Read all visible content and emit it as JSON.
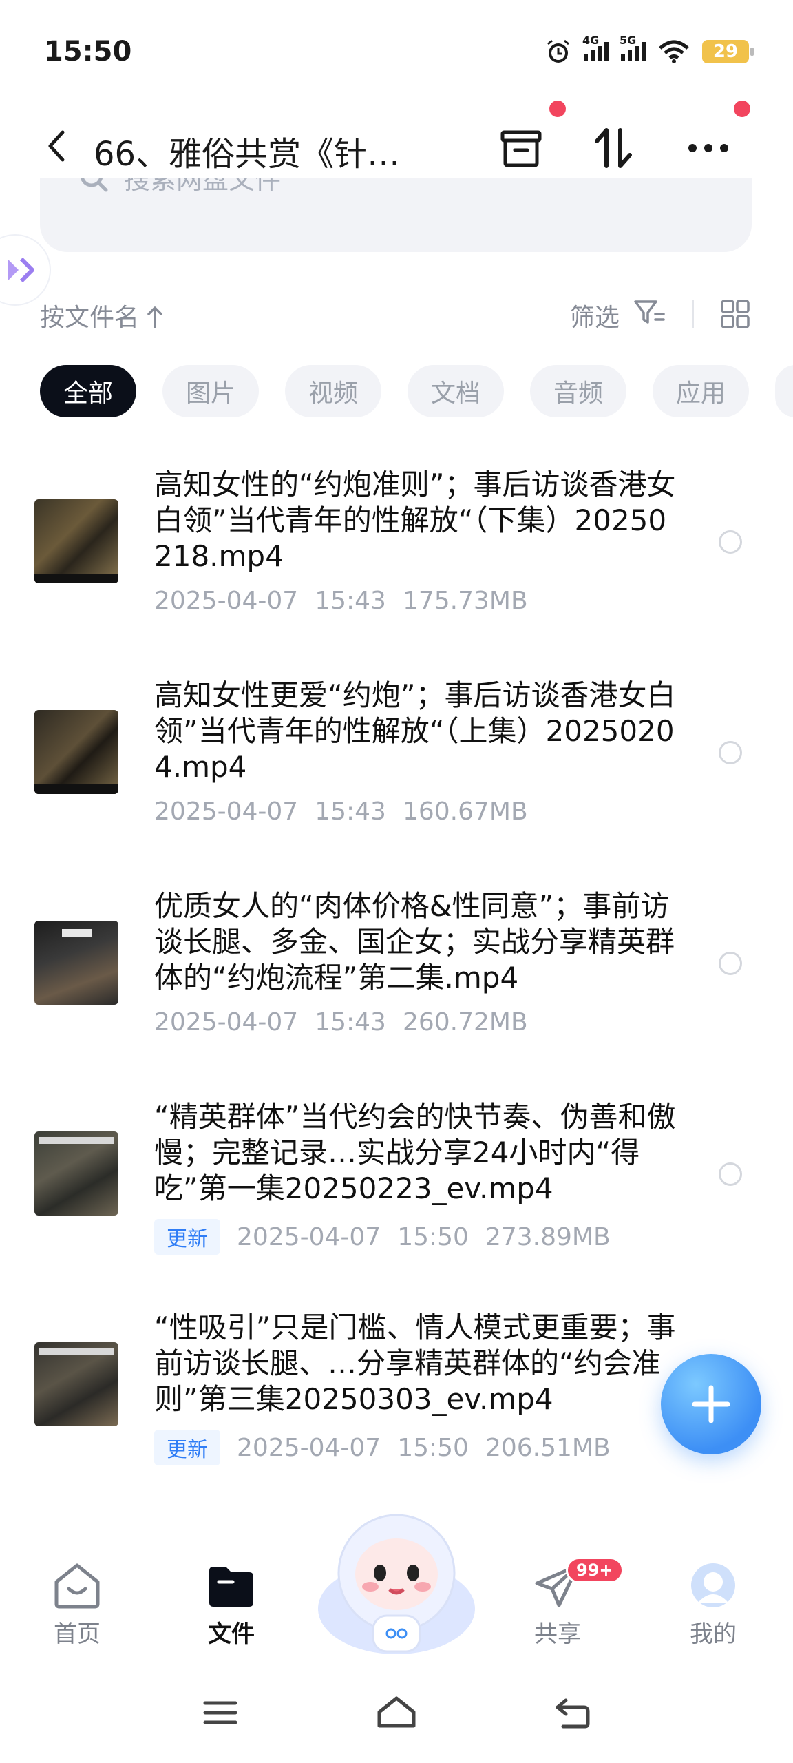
{
  "status_bar": {
    "time": "15:50",
    "network_1": "4G",
    "network_2": "5G",
    "battery": "29"
  },
  "header": {
    "title": "66、雅俗共赏《针…",
    "back_icon": "chevron-left-icon",
    "actions": [
      "archive-icon",
      "sort-transfer-icon",
      "more-icon"
    ]
  },
  "search": {
    "placeholder": "搜索网盘文件"
  },
  "sort_bar": {
    "sort_label": "按文件名",
    "filter_label": "筛选"
  },
  "chips": [
    {
      "label": "全部",
      "active": true
    },
    {
      "label": "图片",
      "active": false
    },
    {
      "label": "视频",
      "active": false
    },
    {
      "label": "文档",
      "active": false
    },
    {
      "label": "音频",
      "active": false
    },
    {
      "label": "应用",
      "active": false
    }
  ],
  "files": [
    {
      "name": "高知女性的“约炮准则”；事后访谈香港女白领”当代青年的性解放“（下集）20250218.mp4",
      "date": "2025-04-07",
      "time": "15:43",
      "size": "175.73MB",
      "badge": ""
    },
    {
      "name": "高知女性更爱“约炮”；事后访谈香港女白领”当代青年的性解放“（上集）20250204.mp4",
      "date": "2025-04-07",
      "time": "15:43",
      "size": "160.67MB",
      "badge": ""
    },
    {
      "name": "优质女人的“肉体价格&性同意”；事前访谈长腿、多金、国企女；实战分享精英群体的“约炮流程”第二集.mp4",
      "date": "2025-04-07",
      "time": "15:43",
      "size": "260.72MB",
      "badge": ""
    },
    {
      "name": "“精英群体”当代约会的快节奏、伪善和傲慢；完整记录…实战分享24小时内“得吃”第一集20250223_ev.mp4",
      "date": "2025-04-07",
      "time": "15:50",
      "size": "273.89MB",
      "badge": "更新"
    },
    {
      "name": "“性吸引”只是门槛、情人模式更重要；事前访谈长腿、…分享精英群体的“约会准则”第三集20250303_ev.mp4",
      "date": "2025-04-07",
      "time": "15:50",
      "size": "206.51MB",
      "badge": "更新"
    }
  ],
  "bottom_nav": [
    {
      "label": "首页",
      "icon": "home-icon",
      "active": false
    },
    {
      "label": "文件",
      "icon": "folder-icon",
      "active": true
    },
    {
      "label": "共享",
      "icon": "paper-plane-icon",
      "active": false,
      "badge": "99+"
    },
    {
      "label": "我的",
      "icon": "avatar-icon",
      "active": false
    }
  ],
  "colors": {
    "accent": "#3d8ff5",
    "badge_red": "#f2455e",
    "chip_active": "#0b0f19"
  }
}
